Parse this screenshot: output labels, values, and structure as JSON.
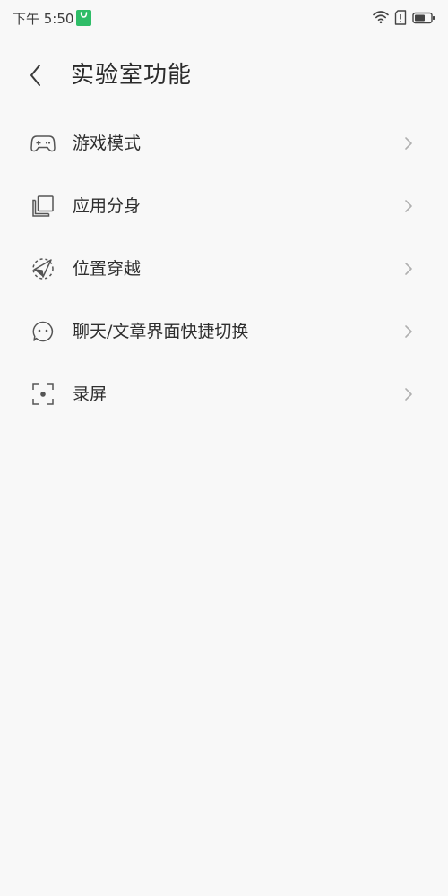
{
  "status_bar": {
    "time": "下午 5:50"
  },
  "header": {
    "title": "实验室功能"
  },
  "menu": {
    "items": [
      {
        "label": "游戏模式",
        "icon": "gamepad-icon"
      },
      {
        "label": "应用分身",
        "icon": "clone-icon"
      },
      {
        "label": "位置穿越",
        "icon": "location-arrow-icon"
      },
      {
        "label": "聊天/文章界面快捷切换",
        "icon": "chat-face-icon"
      },
      {
        "label": "录屏",
        "icon": "screen-record-icon"
      }
    ]
  },
  "colors": {
    "background": "#f8f8f8",
    "notification_green": "#2fbd68",
    "icon_gray": "#555555",
    "chevron_gray": "#b0b0b0"
  }
}
